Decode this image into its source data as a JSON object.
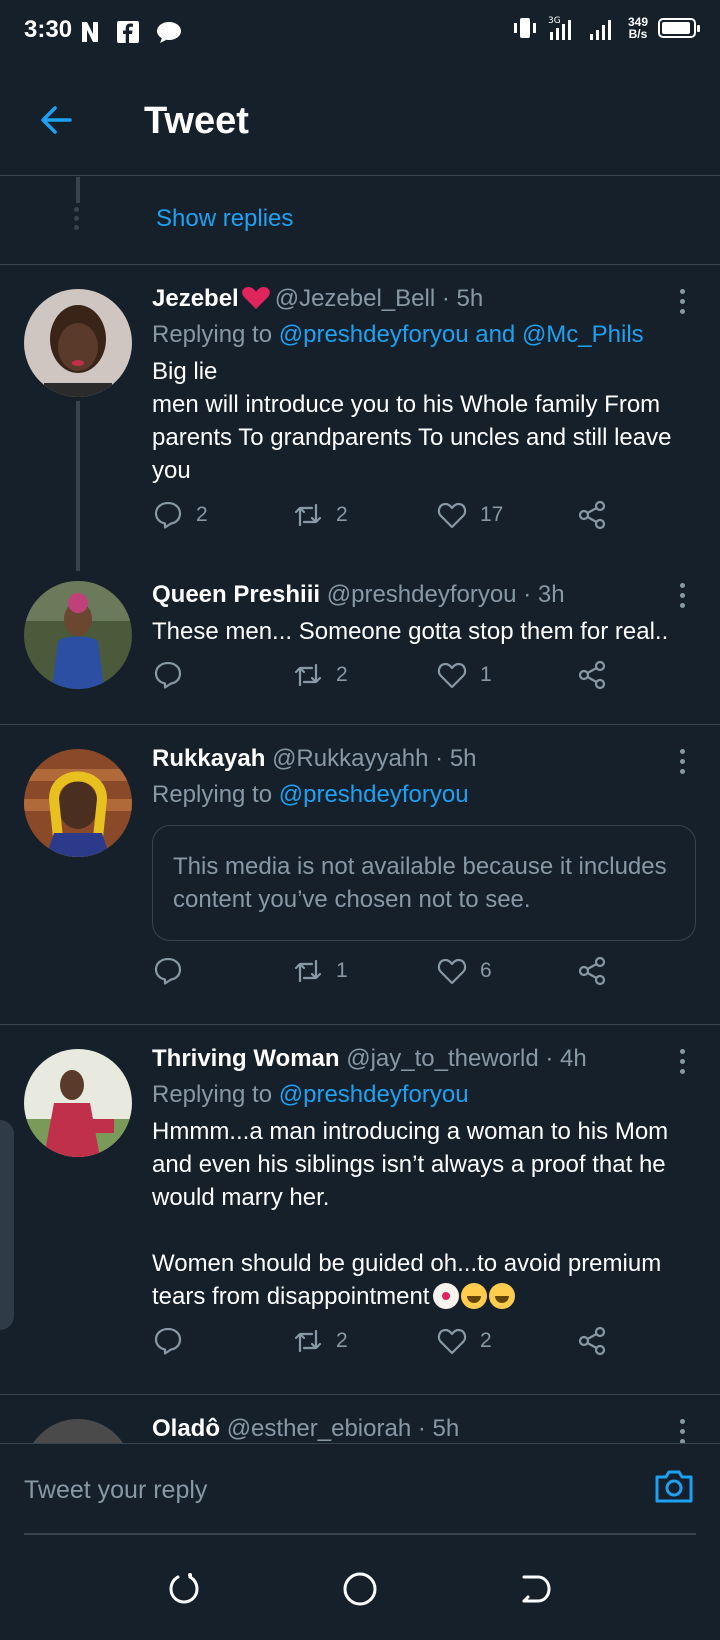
{
  "status_bar": {
    "time": "3:30",
    "speed_value": "349",
    "speed_unit": "B/s",
    "network": "3G"
  },
  "header": {
    "title": "Tweet"
  },
  "show_replies": "Show replies",
  "tweets": [
    {
      "name": "Jezebel",
      "handle": "@Jezebel_Bell",
      "time": "· 5h",
      "replying_prefix": "Replying to",
      "mention1": "@preshdeyforyou",
      "and": "and",
      "mention2": "@Mc_Phils",
      "text_lines": [
        "Big lie",
        "men will introduce you to his Whole family From parents To grandparents To uncles and still leave you"
      ],
      "replies": "2",
      "retweets": "2",
      "likes": "17"
    },
    {
      "name": "Queen Preshiii",
      "handle": "@preshdeyforyou",
      "time": "· 3h",
      "text": "These men... Someone gotta stop them for real..",
      "replies": "",
      "retweets": "2",
      "likes": "1"
    },
    {
      "name": "Rukkayah",
      "handle": "@Rukkayyahh",
      "time": "· 5h",
      "replying_prefix": "Replying to",
      "mention1": "@preshdeyforyou",
      "hidden_media": "This media is not available because it includes content you’ve chosen not to see.",
      "replies": "",
      "retweets": "1",
      "likes": "6"
    },
    {
      "name": "Thriving Woman",
      "handle": "@jay_to_theworld",
      "time": "· 4h",
      "replying_prefix": "Replying to",
      "mention1": "@preshdeyforyou",
      "text_p1": "Hmmm...a man introducing a woman to his Mom and even his siblings isn’t always a proof that he would marry her.",
      "text_p2": "Women should be guided oh...to avoid premium tears from disappointment",
      "replies": "",
      "retweets": "2",
      "likes": "2"
    },
    {
      "name": "Oladô",
      "handle": "@esther_ebiorah",
      "time": "· 5h"
    }
  ],
  "composer": {
    "placeholder": "Tweet your reply"
  },
  "colors": {
    "accent": "#1da1f2",
    "background": "#15202b",
    "muted": "#8899a6",
    "border": "#38444d",
    "heart": "#e0245e"
  }
}
